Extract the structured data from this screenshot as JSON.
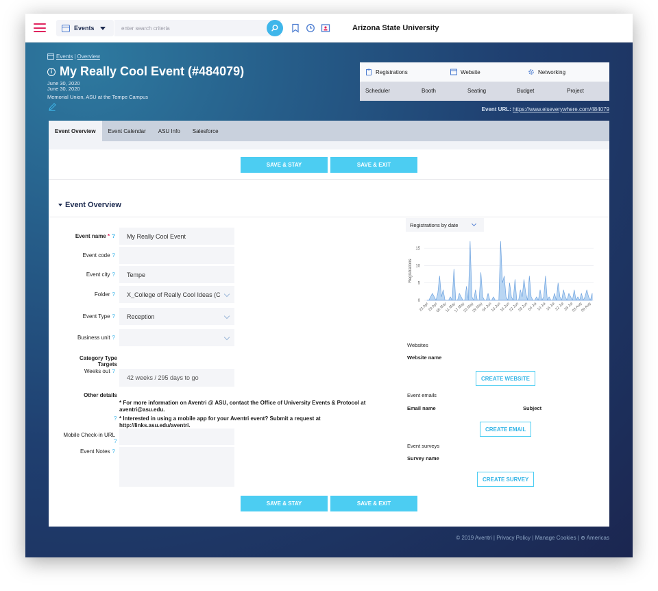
{
  "topbar": {
    "module_label": "Events",
    "search_placeholder": "enter search criteria",
    "org_name": "Arizona State University"
  },
  "header": {
    "breadcrumb": [
      "Events",
      "Overview"
    ],
    "breadcrumb_sep": "|",
    "title": "My Really Cool Event (#484079)",
    "start_date": "June 30, 2020",
    "end_date": "June 30, 2020",
    "venue": "Memorial Union, ASU at the Tempe Campus",
    "url_label": "Event URL:",
    "url": "https://www.eiseverywhere.com/484079"
  },
  "modules": {
    "row1": [
      "Registrations",
      "Website",
      "Networking"
    ],
    "row2": [
      "Scheduler",
      "Booth",
      "Seating",
      "Budget",
      "Project"
    ]
  },
  "tabs": [
    "Event Overview",
    "Event Calendar",
    "ASU Info",
    "Salesforce"
  ],
  "buttons": {
    "save_stay": "SAVE & STAY",
    "save_exit": "SAVE & EXIT"
  },
  "section_title": "Event Overview",
  "form": {
    "event_name_label": "Event name",
    "event_name": "My Really Cool Event",
    "event_code_label": "Event code",
    "event_code": "",
    "event_city_label": "Event city",
    "event_city": "Tempe",
    "folder_label": "Folder",
    "folder": "X_College of Really Cool Ideas (C",
    "event_type_label": "Event Type",
    "event_type": "Reception",
    "business_unit_label": "Business unit",
    "business_unit": "",
    "category_type_label": "Category Type",
    "targets_label": "Targets",
    "weeks_out_label": "Weeks out",
    "weeks_out": "42 weeks / 295 days to go",
    "other_details_label": "Other details",
    "info_1": "* For more information on Aventri @ ASU, contact the Office of University Events & Protocol at aventri@asu.edu.",
    "info_2": "* Interested in using a mobile app for your Aventri event? Submit a request at http://links.asu.edu/aventri.",
    "mobile_checkin_label": "Mobile Check-in URL",
    "event_notes_label": "Event Notes",
    "help_glyph": "?",
    "required_glyph": "*"
  },
  "chart_select": "Registrations by date",
  "chart_data": {
    "type": "area",
    "ylabel": "Registrations",
    "ylim": [
      0,
      17
    ],
    "yticks": [
      0,
      5,
      10,
      15
    ],
    "categories": [
      "23 Apr",
      "29 Apr",
      "05 May",
      "11 May",
      "17 May",
      "23 May",
      "29 May",
      "04 Jun",
      "10 Jun",
      "16 Jun",
      "22 Jun",
      "28 Jun",
      "04 Jul",
      "10 Jul",
      "16 Jul",
      "22 Jul",
      "28 Jul",
      "03 Aug",
      "09 Aug"
    ],
    "values": [
      0,
      0,
      1,
      2,
      1,
      0,
      2,
      7,
      1,
      3,
      0,
      0,
      0,
      1,
      0,
      9,
      0,
      0,
      2,
      1,
      0,
      0,
      4,
      0,
      17,
      1,
      0,
      3,
      0,
      0,
      8,
      1,
      0,
      0,
      2,
      0,
      0,
      1,
      0,
      0,
      0,
      17,
      5,
      7,
      1,
      0,
      5,
      1,
      0,
      6,
      0,
      0,
      3,
      1,
      6,
      2,
      0,
      7,
      1,
      0,
      0,
      1,
      0,
      3,
      0,
      1,
      7,
      0,
      1,
      0,
      0,
      2,
      0,
      5,
      1,
      0,
      3,
      1,
      0,
      2,
      1,
      0,
      3,
      0,
      1,
      0,
      2,
      0,
      1,
      3,
      1,
      0,
      2
    ],
    "grid": true
  },
  "websites": {
    "title": "Websites",
    "column": "Website name",
    "create": "CREATE WEBSITE"
  },
  "emails": {
    "title": "Event emails",
    "col_name": "Email name",
    "col_subject": "Subject",
    "create": "CREATE EMAIL"
  },
  "surveys": {
    "title": "Event surveys",
    "column": "Survey name",
    "create": "CREATE SURVEY"
  },
  "footer": {
    "copyright": "© 2019 Aventri",
    "privacy": "Privacy Policy",
    "cookies": "Manage Cookies",
    "region": "Americas",
    "sep": "|"
  },
  "colors": {
    "accent": "#4ccdf2",
    "brand_pink": "#e0245e",
    "navy": "#1c2a4f",
    "chart_fill": "#b9d6f3",
    "chart_line": "#6fa3df"
  }
}
